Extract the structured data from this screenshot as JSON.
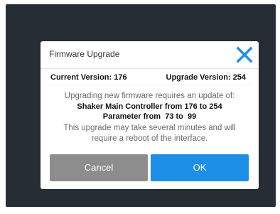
{
  "dialog": {
    "title": "Firmware Upgrade",
    "current_version": "Current Version: 176",
    "upgrade_version": "Upgrade Version: 254",
    "message_intro": "Upgrading new firmware requires an update of:",
    "update_item_1": "Shaker Main Controller from 176 to 254",
    "update_item_2": "Parameter from  73 to  99",
    "note_line_1": "This upgrade may take several minutes and will",
    "note_line_2": "require a reboot of the interface.",
    "cancel_label": "Cancel",
    "ok_label": "OK",
    "close_icon": "close-x-icon"
  },
  "colors": {
    "screen_background": "#262d35",
    "accent": "#1e8fe6",
    "cancel_button": "#8d8d8d",
    "close_icon": "#1e8fe6"
  }
}
